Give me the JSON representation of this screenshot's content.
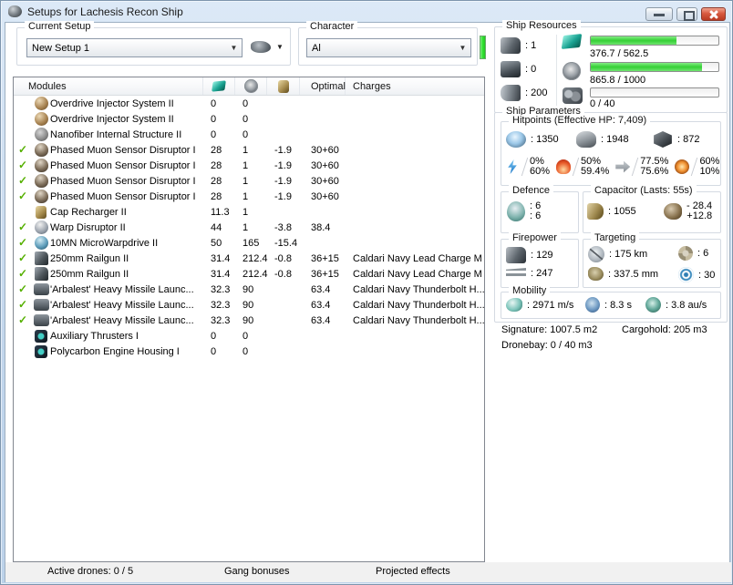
{
  "colors": {
    "progress-green": "#35d035",
    "skill-green": "#2ee12e",
    "check-green": "#55b000"
  },
  "window": {
    "title": "Setups for Lachesis Recon Ship",
    "buttons": [
      "minimize",
      "maximize",
      "close"
    ]
  },
  "current_setup": {
    "label": "Current Setup",
    "value": "New Setup 1"
  },
  "character": {
    "label": "Character",
    "value": "Al"
  },
  "modules_table": {
    "header": {
      "name": "Modules",
      "optimal": "Optimal",
      "charges": "Charges"
    },
    "rows": [
      {
        "check": false,
        "icon": "icon-overdrive",
        "name": "Overdrive Injector System II",
        "cpu": "0",
        "pg": "0",
        "cap": "",
        "optimal": "",
        "charges": ""
      },
      {
        "check": false,
        "icon": "icon-overdrive",
        "name": "Overdrive Injector System II",
        "cpu": "0",
        "pg": "0",
        "cap": "",
        "optimal": "",
        "charges": ""
      },
      {
        "check": false,
        "icon": "icon-nanofiber",
        "name": "Nanofiber Internal Structure II",
        "cpu": "0",
        "pg": "0",
        "cap": "",
        "optimal": "",
        "charges": ""
      },
      {
        "check": true,
        "icon": "icon-disruptor",
        "name": "Phased Muon Sensor Disruptor I",
        "cpu": "28",
        "pg": "1",
        "cap": "-1.9",
        "optimal": "30+60",
        "charges": ""
      },
      {
        "check": true,
        "icon": "icon-disruptor",
        "name": "Phased Muon Sensor Disruptor I",
        "cpu": "28",
        "pg": "1",
        "cap": "-1.9",
        "optimal": "30+60",
        "charges": ""
      },
      {
        "check": true,
        "icon": "icon-disruptor",
        "name": "Phased Muon Sensor Disruptor I",
        "cpu": "28",
        "pg": "1",
        "cap": "-1.9",
        "optimal": "30+60",
        "charges": ""
      },
      {
        "check": true,
        "icon": "icon-disruptor",
        "name": "Phased Muon Sensor Disruptor I",
        "cpu": "28",
        "pg": "1",
        "cap": "-1.9",
        "optimal": "30+60",
        "charges": ""
      },
      {
        "check": false,
        "icon": "icon-cap-recharger",
        "name": "Cap Recharger II",
        "cpu": "11.3",
        "pg": "1",
        "cap": "",
        "optimal": "",
        "charges": ""
      },
      {
        "check": true,
        "icon": "icon-warp-disruptor",
        "name": "Warp Disruptor II",
        "cpu": "44",
        "pg": "1",
        "cap": "-3.8",
        "optimal": "38.4",
        "charges": ""
      },
      {
        "check": true,
        "icon": "icon-mwd",
        "name": "10MN MicroWarpdrive II",
        "cpu": "50",
        "pg": "165",
        "cap": "-15.4",
        "optimal": "",
        "charges": ""
      },
      {
        "check": true,
        "icon": "icon-railgun",
        "name": "250mm Railgun II",
        "cpu": "31.4",
        "pg": "212.4",
        "cap": "-0.8",
        "optimal": "36+15",
        "charges": "Caldari Navy Lead Charge M"
      },
      {
        "check": true,
        "icon": "icon-railgun",
        "name": "250mm Railgun II",
        "cpu": "31.4",
        "pg": "212.4",
        "cap": "-0.8",
        "optimal": "36+15",
        "charges": "Caldari Navy Lead Charge M"
      },
      {
        "check": true,
        "icon": "icon-missile",
        "name": "'Arbalest' Heavy Missile Launc...",
        "cpu": "32.3",
        "pg": "90",
        "cap": "",
        "optimal": "63.4",
        "charges": "Caldari Navy Thunderbolt H..."
      },
      {
        "check": true,
        "icon": "icon-missile",
        "name": "'Arbalest' Heavy Missile Launc...",
        "cpu": "32.3",
        "pg": "90",
        "cap": "",
        "optimal": "63.4",
        "charges": "Caldari Navy Thunderbolt H..."
      },
      {
        "check": true,
        "icon": "icon-missile",
        "name": "'Arbalest' Heavy Missile Launc...",
        "cpu": "32.3",
        "pg": "90",
        "cap": "",
        "optimal": "63.4",
        "charges": "Caldari Navy Thunderbolt H..."
      },
      {
        "check": false,
        "icon": "icon-rig",
        "name": "Auxiliary Thrusters I",
        "cpu": "0",
        "pg": "0",
        "cap": "",
        "optimal": "",
        "charges": ""
      },
      {
        "check": false,
        "icon": "icon-rig",
        "name": "Polycarbon Engine Housing I",
        "cpu": "0",
        "pg": "0",
        "cap": "",
        "optimal": "",
        "charges": ""
      }
    ]
  },
  "footer": {
    "active_drones": "Active drones: 0 / 5",
    "gang_bonuses": "Gang bonuses",
    "projected_effects": "Projected effects"
  },
  "ship_resources": {
    "label": "Ship Resources",
    "turrets": ": 1",
    "launchers": ": 0",
    "calibration": ": 200",
    "cpu": {
      "text": "376.7 / 562.5",
      "pct": 67
    },
    "powergrid": {
      "text": "865.8 / 1000",
      "pct": 87
    },
    "drones": {
      "text": "0 / 40",
      "pct": 0
    }
  },
  "ship_parameters": {
    "label": "Ship Parameters",
    "hitpoints": {
      "label": "Hitpoints (Effective HP: 7,409)",
      "shield": ": 1350",
      "armor": ": 1948",
      "structure": ": 872",
      "resists": [
        {
          "icon": "icon-em",
          "top": "0%",
          "bottom": "60%"
        },
        {
          "icon": "icon-thermal",
          "top": "50%",
          "bottom": "59.4%"
        },
        {
          "icon": "icon-kinetic",
          "top": "77.5%",
          "bottom": "75.6%"
        },
        {
          "icon": "icon-explosive",
          "top": "60%",
          "bottom": "10%"
        }
      ]
    },
    "defence": {
      "label": "Defence",
      "top": ": 6",
      "bottom": ": 6"
    },
    "capacitor": {
      "label": "Capacitor (Lasts: 55s)",
      "amount": ": 1055",
      "drain_top": "- 28.4",
      "drain_bottom": "+12.8"
    },
    "firepower": {
      "label": "Firepower",
      "volley": ": 129",
      "dps": ": 247"
    },
    "targeting": {
      "label": "Targeting",
      "range": ": 175 km",
      "max_targets": ": 6",
      "scan_res": ": 337.5 mm",
      "sensor": ": 30"
    },
    "mobility": {
      "label": "Mobility",
      "speed": ": 2971 m/s",
      "align": ": 8.3 s",
      "warp": ": 3.8 au/s"
    }
  },
  "stats_text": {
    "signature": "Signature: 1007.5 m2",
    "cargohold": "Cargohold: 205 m3",
    "dronebay": "Dronebay: 0 / 40 m3"
  }
}
